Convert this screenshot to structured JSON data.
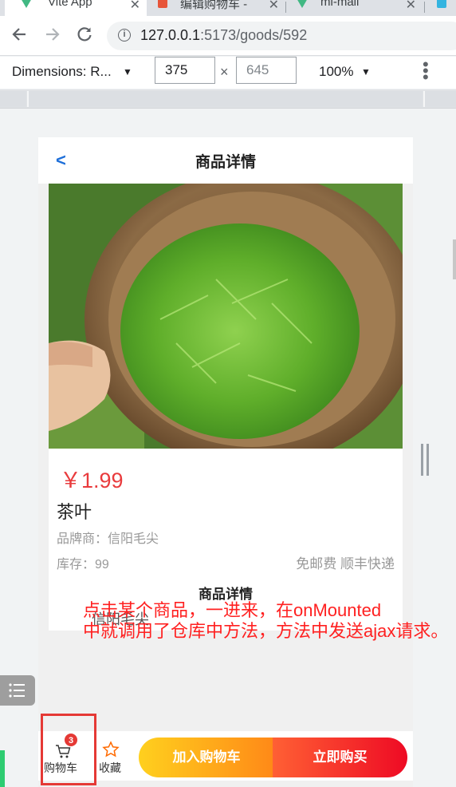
{
  "browser": {
    "tabs": [
      {
        "title": "Vite App",
        "favicon": "vite-icon",
        "active": true
      },
      {
        "title": "编辑购物车 - ",
        "favicon": "red-doc-icon",
        "active": false
      },
      {
        "title": "mi-mall",
        "favicon": "vite-icon",
        "active": false
      }
    ],
    "url_host": "127.0.0.1",
    "url_path": ":5173/goods/592"
  },
  "devtools": {
    "dimensions_label": "Dimensions: R...",
    "width_value": "375",
    "height_placeholder": "645",
    "zoom": "100%"
  },
  "page": {
    "header_title": "商品详情",
    "price": "￥1.99",
    "name": "茶叶",
    "brand": "品牌商：信阳毛尖",
    "stock": "库存：99",
    "shipping": "免邮费 顺丰快递",
    "detail_heading": "商品详情",
    "detail_text": "信阳毛尖"
  },
  "annotation": {
    "line1": "点击某个商品，一进来，在onMounted",
    "line2": "中就调用了仓库中方法，方法中发送ajax请求。"
  },
  "bottom_bar": {
    "cart_label": "购物车",
    "cart_badge": "3",
    "fav_label": "收藏",
    "add_cart_label": "加入购物车",
    "buy_label": "立即购买"
  },
  "colors": {
    "price_red": "#e93b3d",
    "annotation_red": "#ff2020",
    "link_blue": "#1e6fd9"
  }
}
